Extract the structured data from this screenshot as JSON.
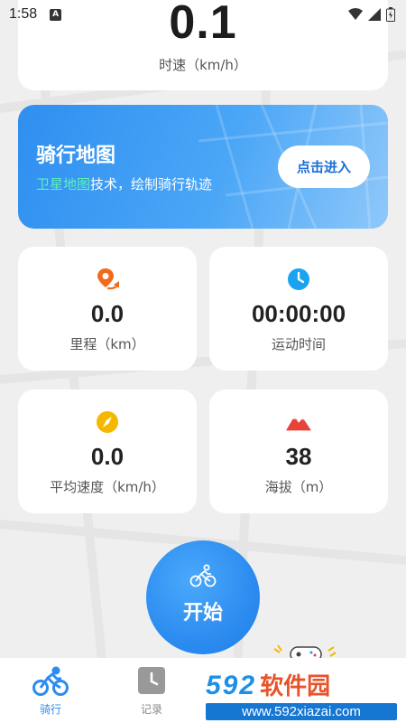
{
  "status_bar": {
    "time": "1:58",
    "notif_letter": "A"
  },
  "speed": {
    "value": "0.1",
    "unit": "时速（km/h）"
  },
  "map_banner": {
    "title": "骑行地图",
    "subtitle_highlight": "卫星地图",
    "subtitle_rest": "技术，绘制骑行轨迹",
    "button_label": "点击进入"
  },
  "stats": {
    "distance": {
      "value": "0.0",
      "label": "里程（km）"
    },
    "duration": {
      "value": "00:00:00",
      "label": "运动时间"
    },
    "avg_speed": {
      "value": "0.0",
      "label": "平均速度（km/h）"
    },
    "altitude": {
      "value": "38",
      "label": "海拔（m）"
    }
  },
  "start_button": {
    "label": "开始"
  },
  "nav": {
    "items": [
      {
        "label": "骑行",
        "icon": "bike-icon",
        "active": true
      },
      {
        "label": "记录",
        "icon": "clock-icon",
        "active": false
      }
    ]
  },
  "watermark": {
    "brand_num": "592",
    "brand_cn": "软件园",
    "url": "www.592xiazai.com"
  },
  "colors": {
    "accent": "#2d8cf0",
    "highlight": "#5ef2b8",
    "distance_icon": "#f26b1d",
    "duration_icon": "#1aa3f0",
    "speed_icon": "#f5b800",
    "altitude_icon": "#e8433a"
  }
}
